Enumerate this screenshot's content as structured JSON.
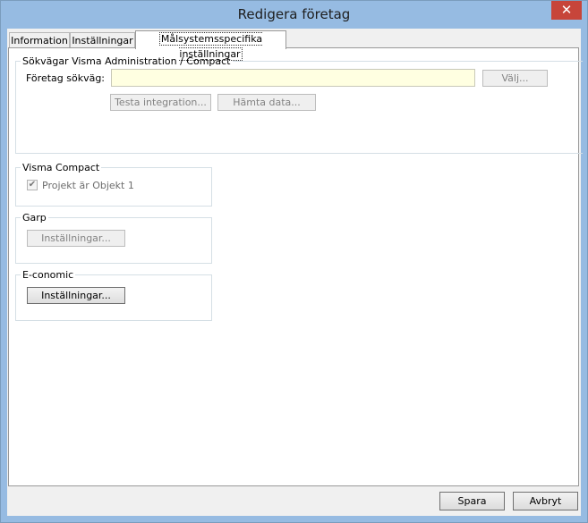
{
  "window": {
    "title": "Redigera företag",
    "close_glyph": "✕"
  },
  "tabs": [
    {
      "label": "Information"
    },
    {
      "label": "Inställningar"
    },
    {
      "label": "Målsystemsspecifika inställningar"
    }
  ],
  "paths_group": {
    "title": "Sökvägar Visma Administration / Compact",
    "company_path_label": "Företag sökväg:",
    "company_path_value": "",
    "choose_button": "Välj...",
    "test_integration_button": "Testa integration...",
    "fetch_data_button": "Hämta data..."
  },
  "visma_compact": {
    "title": "Visma Compact",
    "checkbox_label": "Projekt är Objekt 1",
    "checkbox_glyph": "✔",
    "checked": true
  },
  "garp": {
    "title": "Garp",
    "settings_button": "Inställningar..."
  },
  "economic": {
    "title": "E-conomic",
    "settings_button": "Inställningar..."
  },
  "footer": {
    "save_button": "Spara",
    "cancel_button": "Avbryt"
  }
}
